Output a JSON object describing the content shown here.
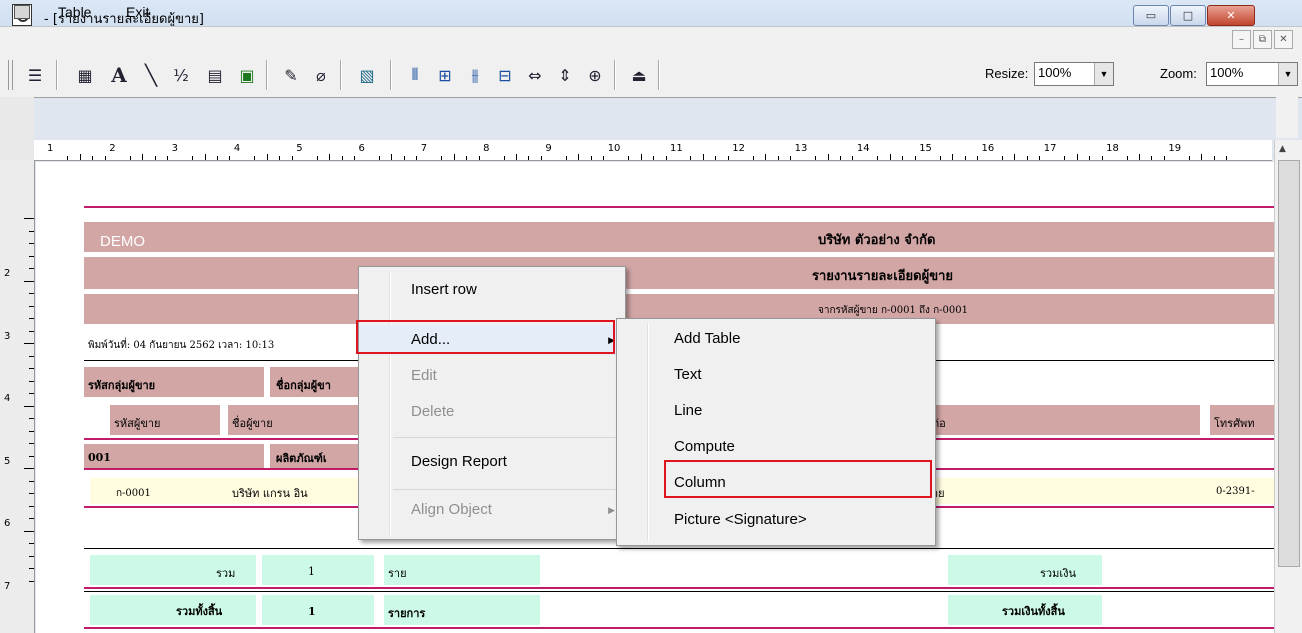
{
  "window": {
    "title": " - [รายงานรายละเอียดผู้ขาย]",
    "min_glyph": "▭",
    "max_glyph": "□",
    "close_glyph": "✕"
  },
  "menubar": {
    "items": [
      "Table",
      "Exit"
    ],
    "mdi_min": "–",
    "mdi_restore": "⧉",
    "mdi_close": "✕"
  },
  "toolbar": {
    "resize_label": "Resize:",
    "resize_value": "100%",
    "zoom_label": "Zoom:",
    "zoom_value": "100%"
  },
  "ruler": {
    "top_numbers": [
      "1",
      "2",
      "3",
      "4",
      "5",
      "6",
      "7",
      "8",
      "9",
      "10",
      "11",
      "12",
      "13",
      "14",
      "15",
      "16",
      "17",
      "18",
      "19"
    ],
    "left_numbers": [
      "2",
      "3",
      "4",
      "5",
      "6",
      "7"
    ]
  },
  "report": {
    "demo": "DEMO",
    "company": "บริษัท ตัวอย่าง จำกัด",
    "report_title": "รายงานรายละเอียดผู้ขาย",
    "range": "จากรหัสผู้ขาย ก-0001 ถึง ก-0001",
    "print_info": "พิมพ์วันที่: 04 กันยายน 2562 เวลา: 10:13",
    "col_group_code": "รหัสกลุ่มผู้ขาย",
    "col_group_name": "ชื่อกลุ่มผู้ขา",
    "col_vendor_code": "รหัสผู้ขาย",
    "col_vendor_name": "ชื่อผู้ขาย",
    "col_contact": "ต่อ",
    "col_phone": "โทรศัพท",
    "group_code": "001",
    "group_name": "ผลิตภัณฑ์เ",
    "vendor_code": "ก-0001",
    "vendor_name": "บริษัท แกรน อิน",
    "vendor_contact": "าย",
    "vendor_phone": "0-2391-",
    "sum_label": "รวม",
    "sum_count": "1",
    "sum_unit": "ราย",
    "sum_money": "รวมเงิน",
    "total_label": "รวมทั้งสิ้น",
    "total_count": "1",
    "total_unit": "รายการ",
    "total_money": "รวมเงินทั้งสิ้น"
  },
  "context_menu": {
    "items": [
      {
        "label": "Insert row",
        "enabled": true
      },
      {
        "label": "Add...",
        "enabled": true,
        "submenu": true
      },
      {
        "label": "Edit",
        "enabled": false
      },
      {
        "label": "Delete",
        "enabled": false
      },
      {
        "label": "Design Report",
        "enabled": true
      },
      {
        "label": "Align Object",
        "enabled": false,
        "submenu": true
      }
    ],
    "submenu_arrow": "▶"
  },
  "submenu": {
    "items": [
      "Add Table",
      "Text",
      "Line",
      "Compute",
      "Column",
      "Picture <Signature>"
    ]
  },
  "colors": {
    "band": "#d3a6a6",
    "accent_line": "#c21b6b",
    "highlight_box": "#e0141e",
    "mint": "#cdfae6",
    "cream": "#fffce0"
  }
}
